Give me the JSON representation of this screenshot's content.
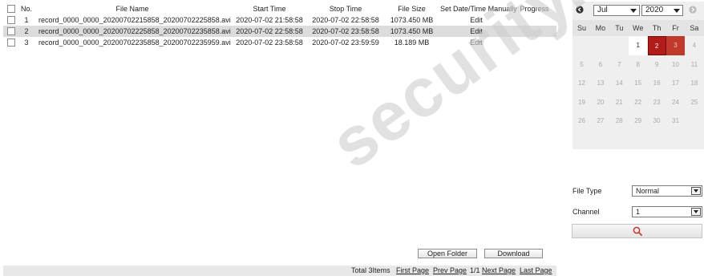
{
  "table": {
    "headers": [
      "No.",
      "File Name",
      "Start Time",
      "Stop Time",
      "File Size",
      "Set Date/Time Manually",
      "Progress"
    ],
    "rows": [
      {
        "no": "1",
        "file_name": "record_0000_0000_20200702215858_20200702225858.avi",
        "start": "2020-07-02 21:58:58",
        "stop": "2020-07-02 22:58:58",
        "size": "1073.450 MB",
        "action": "Edit"
      },
      {
        "no": "2",
        "file_name": "record_0000_0000_20200702225858_20200702235858.avi",
        "start": "2020-07-02 22:58:58",
        "stop": "2020-07-02 23:58:58",
        "size": "1073.450 MB",
        "action": "Edit"
      },
      {
        "no": "3",
        "file_name": "record_0000_0000_20200702235858_20200702235959.avi",
        "start": "2020-07-02 23:58:58",
        "stop": "2020-07-02 23:59:59",
        "size": "18.189 MB",
        "action": "Edit"
      }
    ]
  },
  "actions": {
    "open_folder": "Open Folder",
    "download": "Download"
  },
  "pager": {
    "total": "Total 3Items",
    "first": "First Page",
    "prev": "Prev Page",
    "page": "1/1",
    "next": "Next Page",
    "last": "Last Page"
  },
  "calendar": {
    "month": "Jul",
    "year": "2020",
    "weekdays": [
      "Su",
      "Mo",
      "Tu",
      "We",
      "Th",
      "Fr",
      "Sa"
    ],
    "days": [
      "1",
      "2",
      "3",
      "4",
      "5",
      "6",
      "7",
      "8",
      "9",
      "10",
      "11",
      "12",
      "13",
      "14",
      "15",
      "16",
      "17",
      "18",
      "19",
      "20",
      "21",
      "22",
      "23",
      "24",
      "25",
      "26",
      "27",
      "28",
      "29",
      "30",
      "31"
    ],
    "selected_day": "2",
    "days_with_records": [
      "1",
      "2",
      "3"
    ],
    "colors": {
      "selected": "#b31b1b",
      "record": "#c0392b"
    }
  },
  "search": {
    "file_type_label": "File Type",
    "file_type_value": "Normal",
    "channel_label": "Channel",
    "channel_value": "1"
  },
  "watermark": "security.com"
}
